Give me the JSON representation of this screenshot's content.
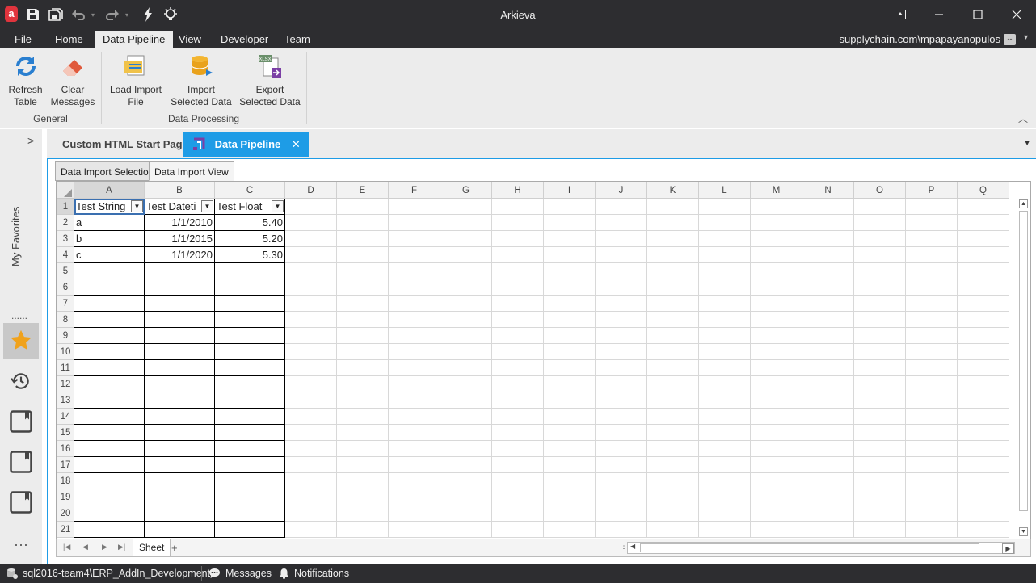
{
  "window": {
    "title": "Arkieva",
    "logo_letter": "a",
    "quick_access": [
      "save-icon",
      "save-all-icon",
      "undo-icon",
      "redo-icon",
      "lightning-icon",
      "lightbulb-icon"
    ]
  },
  "menu": {
    "tabs": [
      "File",
      "Home",
      "Data Pipeline",
      "View",
      "Developer",
      "Team"
    ],
    "active_tab": "Data Pipeline",
    "account": "supplychain.com\\mpapayanopulos",
    "account_button": "--"
  },
  "ribbon": {
    "buttons": [
      {
        "label": "Refresh\nTable",
        "line1": "Refresh",
        "line2": "Table",
        "icon": "refresh-icon"
      },
      {
        "label": "Clear\nMessages",
        "line1": "Clear",
        "line2": "Messages",
        "icon": "eraser-icon"
      },
      {
        "label": "Load Import\nFile",
        "line1": "Load Import",
        "line2": "File",
        "icon": "load-file-icon"
      },
      {
        "label": "Import\nSelected Data",
        "line1": "Import",
        "line2": "Selected Data",
        "icon": "database-icon"
      },
      {
        "label": "Export\nSelected Data",
        "line1": "Export",
        "line2": "Selected Data",
        "icon": "export-xlsx-icon"
      }
    ],
    "groups": [
      "General",
      "Data Processing"
    ],
    "xlsx_badge": "XLSX"
  },
  "left_panel": {
    "favorites_label": "My Favorites",
    "dots": "......",
    "more": "···"
  },
  "doc_tabs": {
    "tabs": [
      "Custom HTML Start Page",
      "Data Pipeline"
    ],
    "active": "Data Pipeline",
    "close": "✕"
  },
  "sub_tabs": [
    "Data Import Selection",
    "Data Import View"
  ],
  "active_sub_tab": "Data Import View",
  "sheet": {
    "columns": [
      "A",
      "B",
      "C",
      "D",
      "E",
      "F",
      "G",
      "H",
      "I",
      "J",
      "K",
      "L",
      "M",
      "N",
      "O",
      "P",
      "Q"
    ],
    "row_numbers": [
      "1",
      "2",
      "3",
      "4",
      "5",
      "6",
      "7",
      "8",
      "9",
      "10",
      "11",
      "12",
      "13",
      "14",
      "15",
      "16",
      "17",
      "18",
      "19",
      "20",
      "21"
    ],
    "headers": [
      "Test String",
      "Test Dateti",
      "Test Float"
    ],
    "rows": [
      [
        "a",
        "1/1/2010",
        "5.40"
      ],
      [
        "b",
        "1/1/2015",
        "5.20"
      ],
      [
        "c",
        "1/1/2020",
        "5.30"
      ]
    ],
    "sheet_name": "Sheet",
    "add_sheet": "+"
  },
  "status": {
    "connection": "sql2016-team4\\ERP_AddIn_Development",
    "messages": "Messages",
    "notifications": "Notifications"
  },
  "colors": {
    "chrome": "#2d2d30",
    "ribbon": "#ececec",
    "accent": "#1e9ce6",
    "favorite": "#f0a21c"
  }
}
